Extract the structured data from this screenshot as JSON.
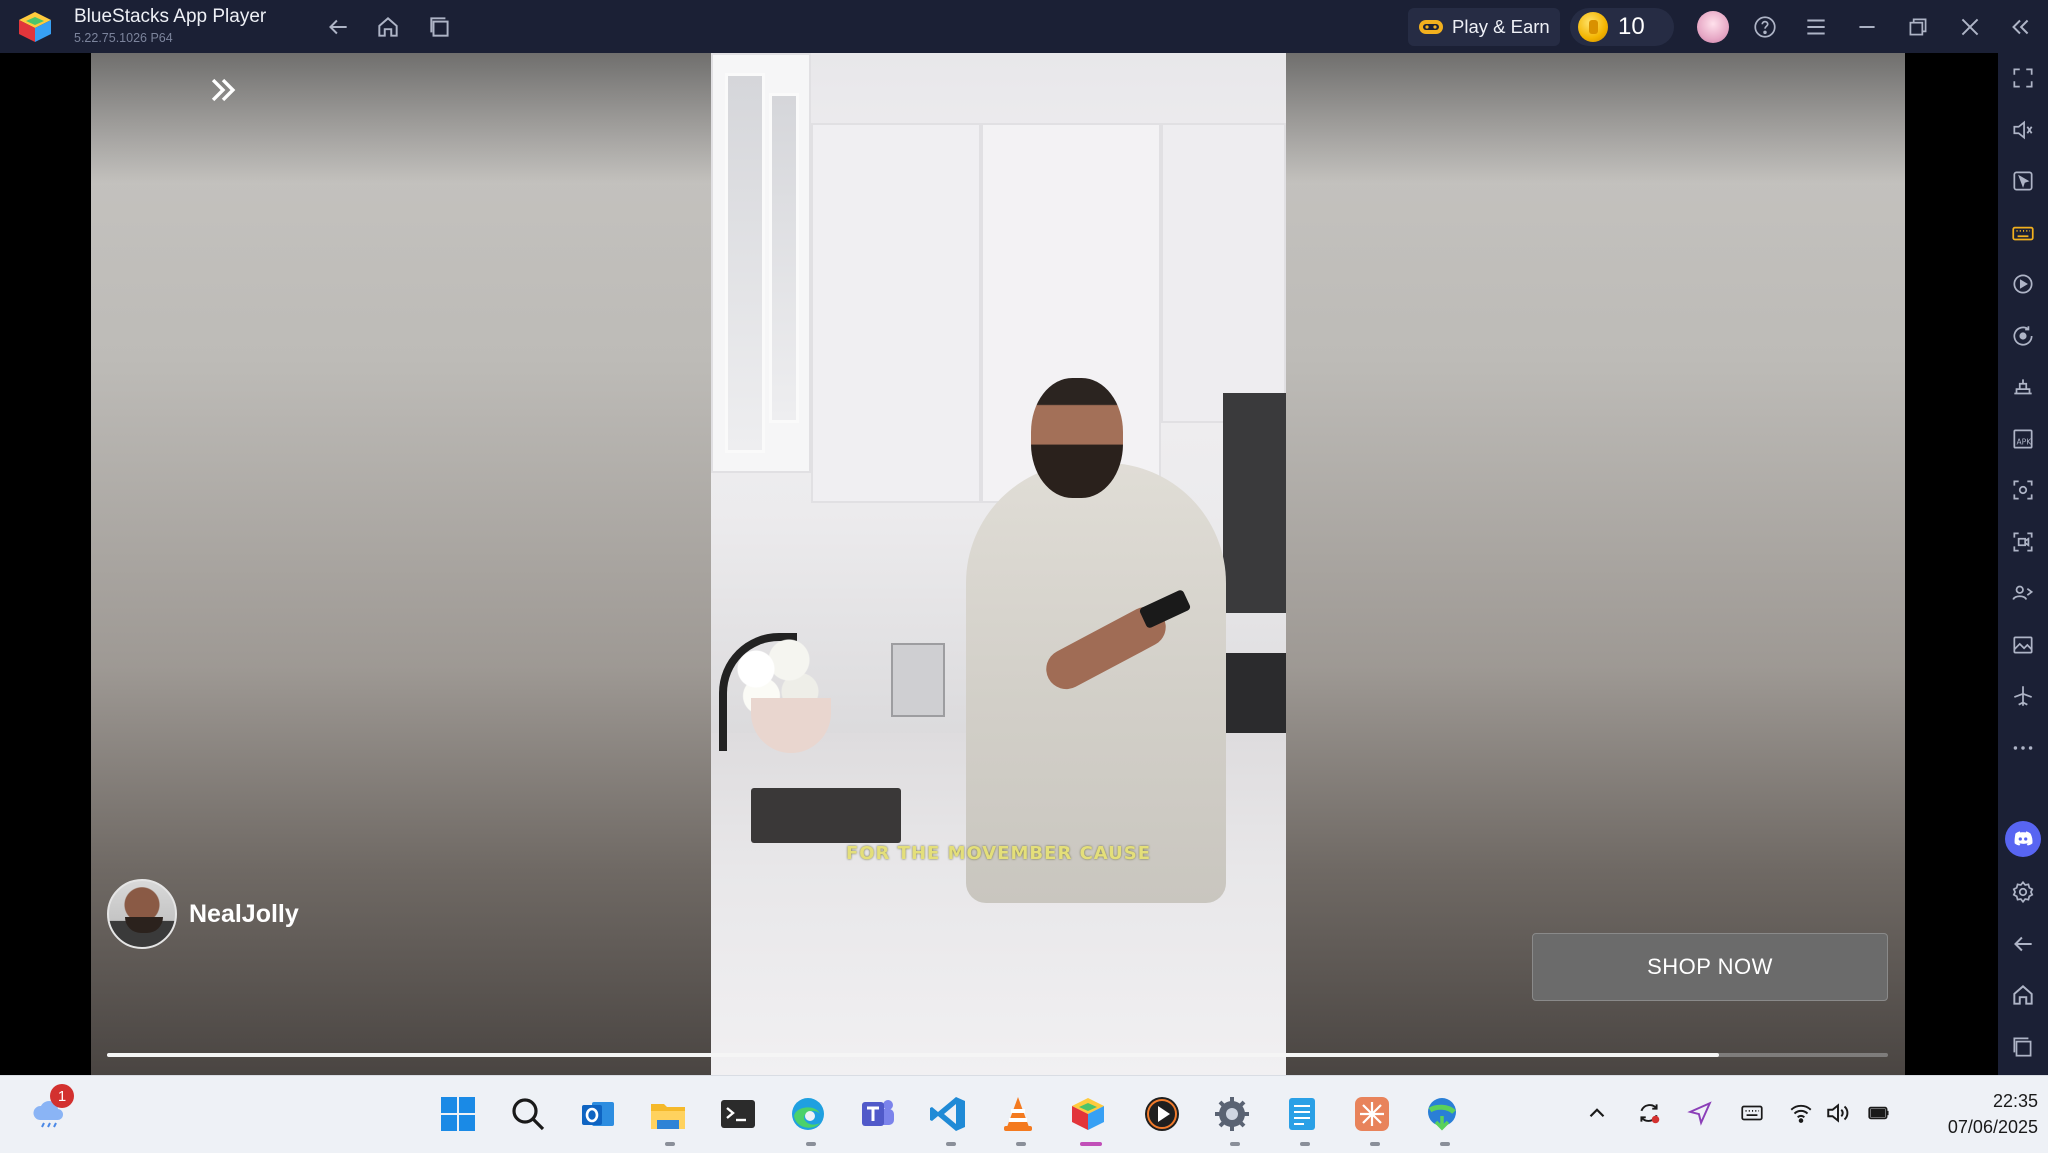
{
  "titlebar": {
    "app_name": "BlueStacks App Player",
    "version": "5.22.75.1026 P64",
    "play_earn_label": "Play & Earn",
    "coin_count": "10"
  },
  "ad": {
    "caption": "FOR THE MOVEMBER CAUSE",
    "advertiser_name": "NealJolly",
    "cta_label": "SHOP NOW",
    "progress_fraction": 0.905
  },
  "sidebar": {
    "items": [
      "fullscreen-icon",
      "volume-icon",
      "pointer-icon",
      "keyboard-icon",
      "macro-icon",
      "rotate-icon",
      "controls-icon",
      "apk-icon",
      "screenshot-icon",
      "record-icon",
      "multi-instance-icon",
      "media-folder-icon",
      "airplane-icon",
      "more-icon",
      "discord-icon",
      "settings-icon",
      "back-icon",
      "home-icon",
      "recent-apps-icon"
    ]
  },
  "taskbar": {
    "weather_badge": "1",
    "time": "22:35",
    "date": "07/06/2025"
  },
  "colors": {
    "titlebar_bg": "#1b2035",
    "caption_color": "#e4df7a",
    "active_indicator": "#c14fb8"
  }
}
